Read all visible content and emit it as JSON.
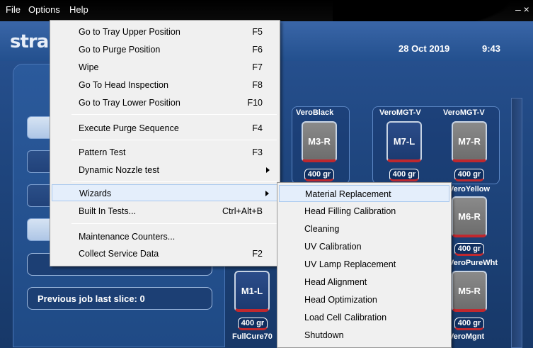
{
  "menubar": {
    "file": "File",
    "options": "Options",
    "help": "Help",
    "close": "– ×"
  },
  "header": {
    "logo": "stra",
    "date": "28 Oct 2019",
    "time": "9:43"
  },
  "status": {
    "previous_job": "Previous job last slice: 0"
  },
  "materials": {
    "top_labels": [
      "VeroBlack",
      "VeroMGT-V",
      "VeroMGT-V"
    ],
    "mid_labels": [
      "VeroYellow",
      "VeroPureWht"
    ],
    "bottom_labels": [
      "FullCure70",
      "VeroMgnt"
    ],
    "cartridges": [
      {
        "id": "M3-R",
        "weight": "400 gr",
        "color": "gray"
      },
      {
        "id": "M7-L",
        "weight": "400 gr",
        "color": "navy"
      },
      {
        "id": "M7-R",
        "weight": "400 gr",
        "color": "gray"
      },
      {
        "id": "M6-R",
        "weight": "400 gr",
        "color": "gray"
      },
      {
        "id": "M1-L",
        "weight": "400 gr",
        "color": "navy"
      },
      {
        "id": "M5-R",
        "weight": "400 gr",
        "color": "gray"
      }
    ]
  },
  "options_menu": {
    "items": [
      {
        "label": "Go to Tray Upper Position",
        "shortcut": "F5"
      },
      {
        "label": "Go to Purge Position",
        "shortcut": "F6"
      },
      {
        "label": "Wipe",
        "shortcut": "F7"
      },
      {
        "label": "Go To Head Inspection",
        "shortcut": "F8"
      },
      {
        "label": "Go to Tray Lower Position",
        "shortcut": "F10"
      },
      {
        "label": "Execute Purge Sequence",
        "shortcut": "F4"
      },
      {
        "label": "Pattern Test",
        "shortcut": "F3"
      },
      {
        "label": "Dynamic Nozzle test",
        "shortcut": ""
      },
      {
        "label": "Wizards",
        "shortcut": ""
      },
      {
        "label": "Built In Tests...",
        "shortcut": "Ctrl+Alt+B"
      },
      {
        "label": "Maintenance Counters...",
        "shortcut": ""
      },
      {
        "label": "Collect Service Data",
        "shortcut": "F2"
      }
    ]
  },
  "wizards_menu": {
    "items": [
      "Material Replacement",
      "Head Filling Calibration",
      "Cleaning",
      "UV Calibration",
      "UV Lamp Replacement",
      "Head Alignment",
      "Head Optimization",
      "Load Cell Calibration",
      "Shutdown"
    ]
  }
}
